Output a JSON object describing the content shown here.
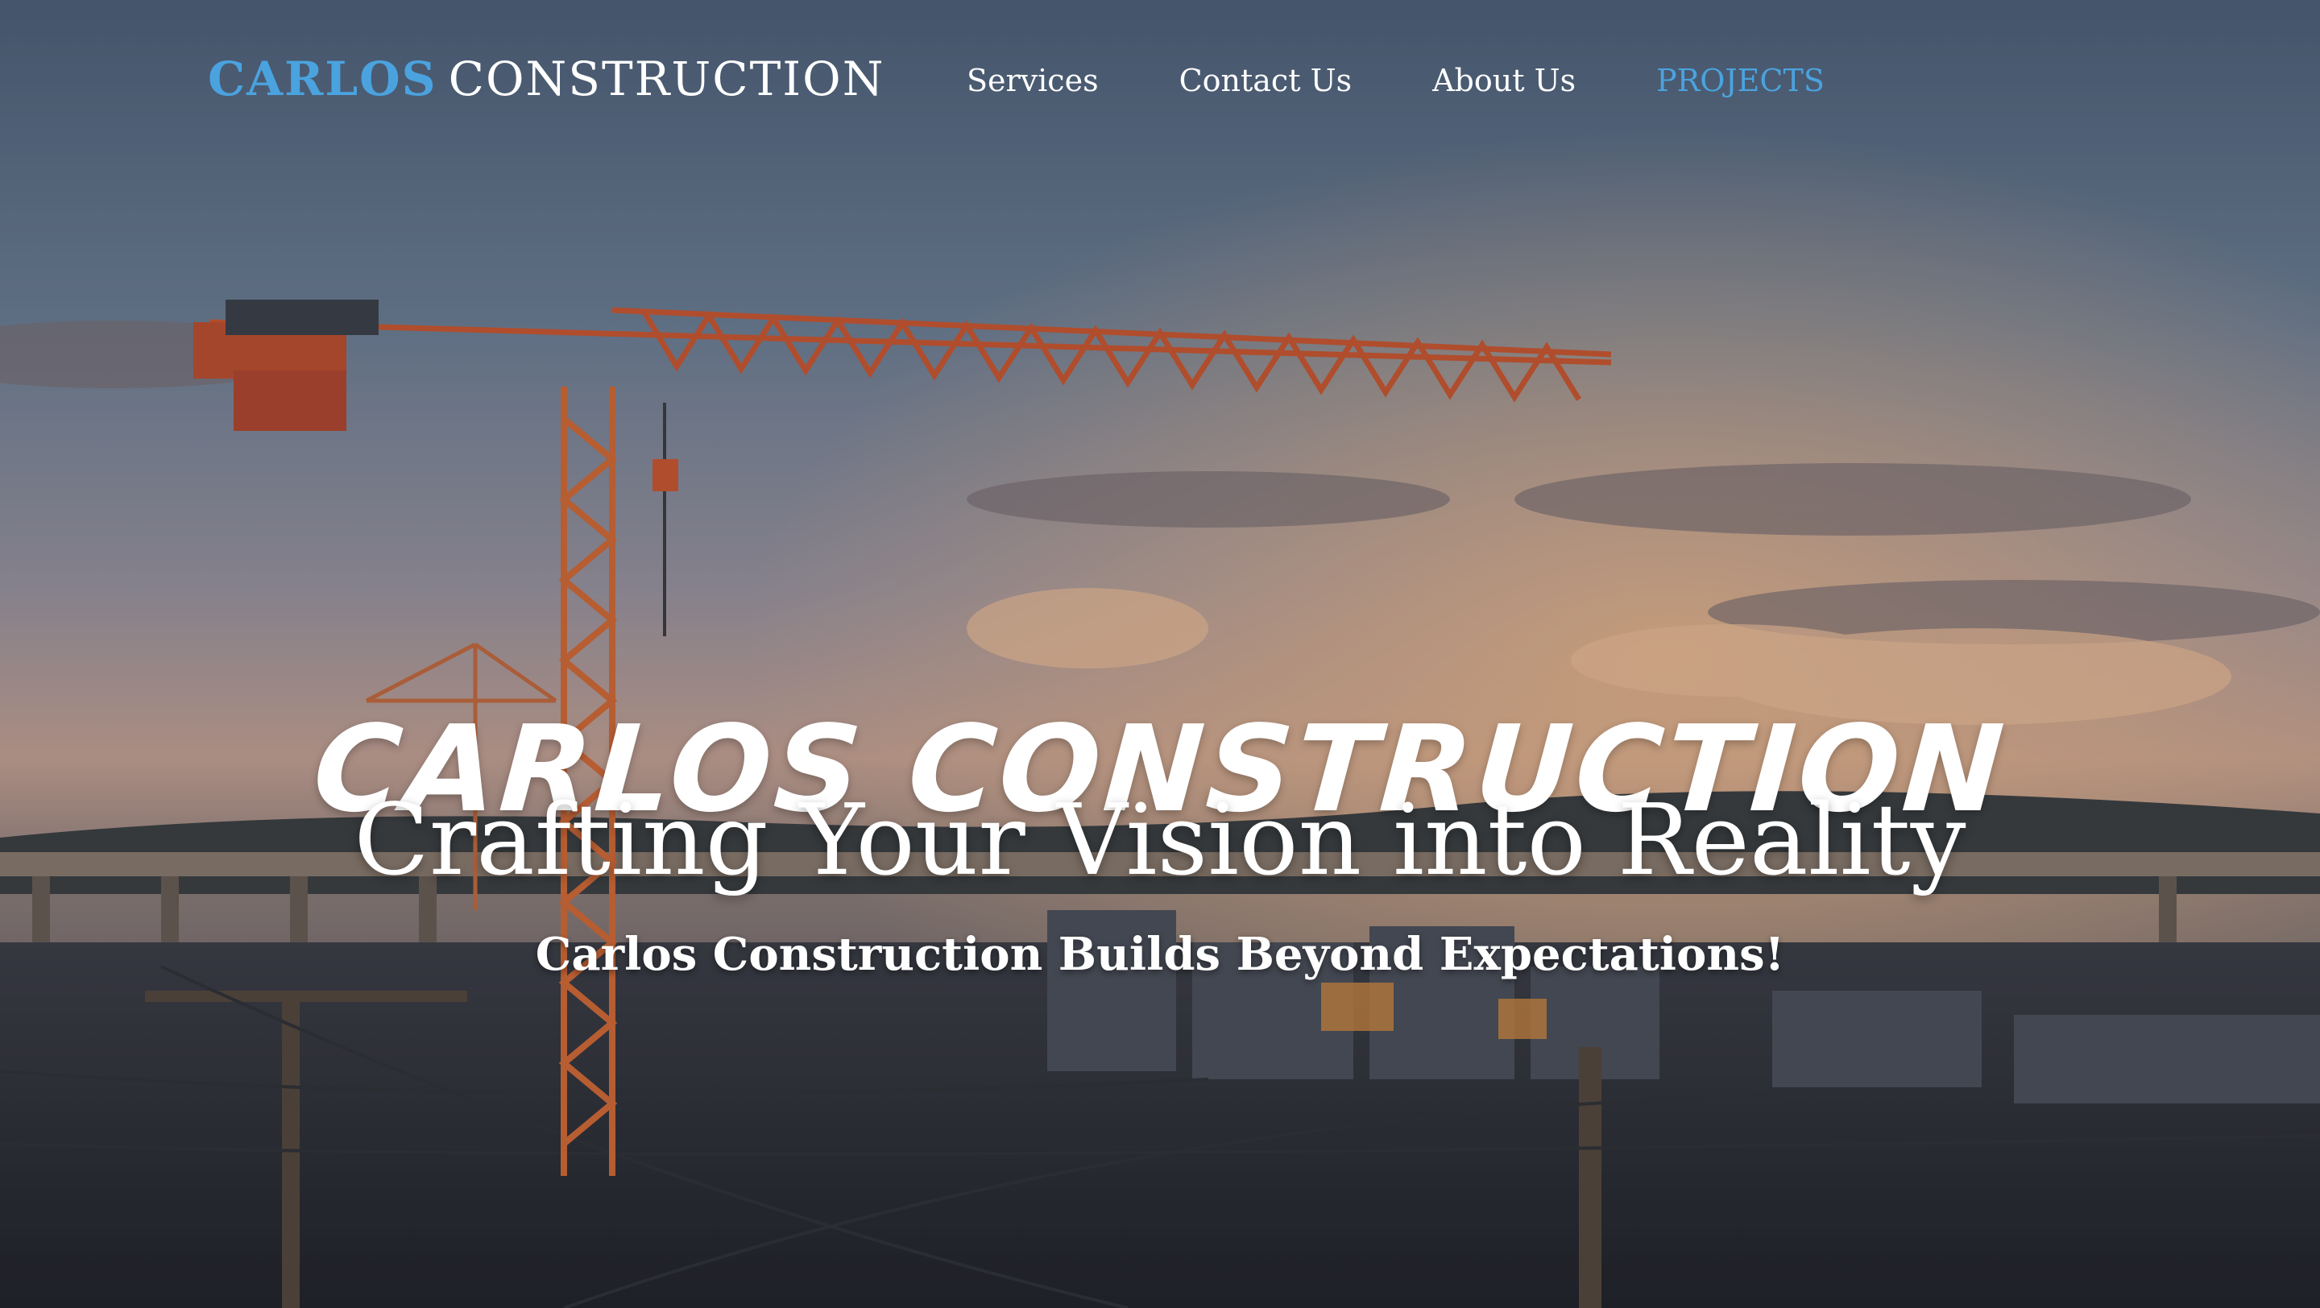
{
  "header": {
    "brand_first": "CARLOS",
    "brand_second": "CONSTRUCTION",
    "nav": [
      {
        "label": "Services"
      },
      {
        "label": "Contact Us"
      },
      {
        "label": "About Us"
      },
      {
        "label": "PROJECTS"
      }
    ],
    "active_nav": "PROJECTS"
  },
  "hero": {
    "headline": "CARLOS CONSTRUCTION",
    "tagline": "Crafting Your Vision into Reality",
    "subline": "Carlos Construction Builds Beyond Expectations!"
  },
  "colors": {
    "accent": "#4aa3df",
    "text": "#ffffff",
    "sky_top": "#566a82",
    "sky_glow": "#e6a57a",
    "crane": "#c4572c"
  }
}
